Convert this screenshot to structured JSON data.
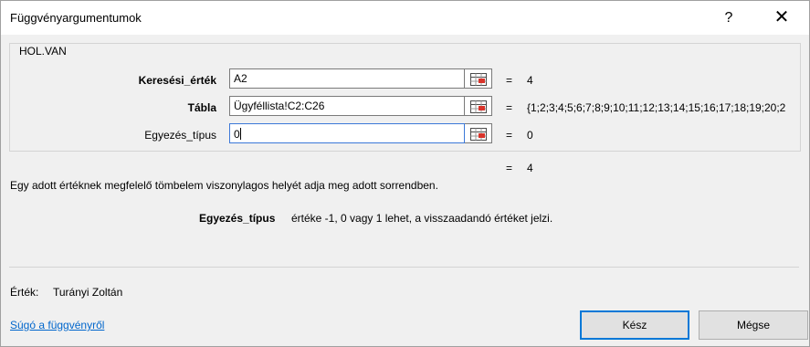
{
  "window": {
    "title": "Függvényargumentumok",
    "help_glyph": "?",
    "close_glyph": "✕"
  },
  "function": {
    "name": "HOL.VAN",
    "arguments": [
      {
        "label": "Keresési_érték",
        "bold": true,
        "value": "A2",
        "result": "4"
      },
      {
        "label": "Tábla",
        "bold": true,
        "value": "Ügyféllista!C2:C26",
        "result": "{1;2;3;4;5;6;7;8;9;10;11;12;13;14;15;16;17;18;19;20;2"
      },
      {
        "label": "Egyezés_típus",
        "bold": false,
        "value": "0",
        "result": "0"
      }
    ],
    "equals_sign": "=",
    "formula_result": "4",
    "description": "Egy adott értéknek megfelelő tömbelem viszonylagos helyét adja meg adott sorrendben.",
    "param_name": "Egyezés_típus",
    "param_description": "értéke -1, 0 vagy 1 lehet, a visszaadandó értéket jelzi."
  },
  "footer": {
    "value_label": "Érték:",
    "value_text": "Turányi Zoltán",
    "help_link": "Súgó a függvényről",
    "ok_label": "Kész",
    "cancel_label": "Mégse"
  },
  "colors": {
    "link": "#0066cc",
    "accent": "#0078d7"
  }
}
